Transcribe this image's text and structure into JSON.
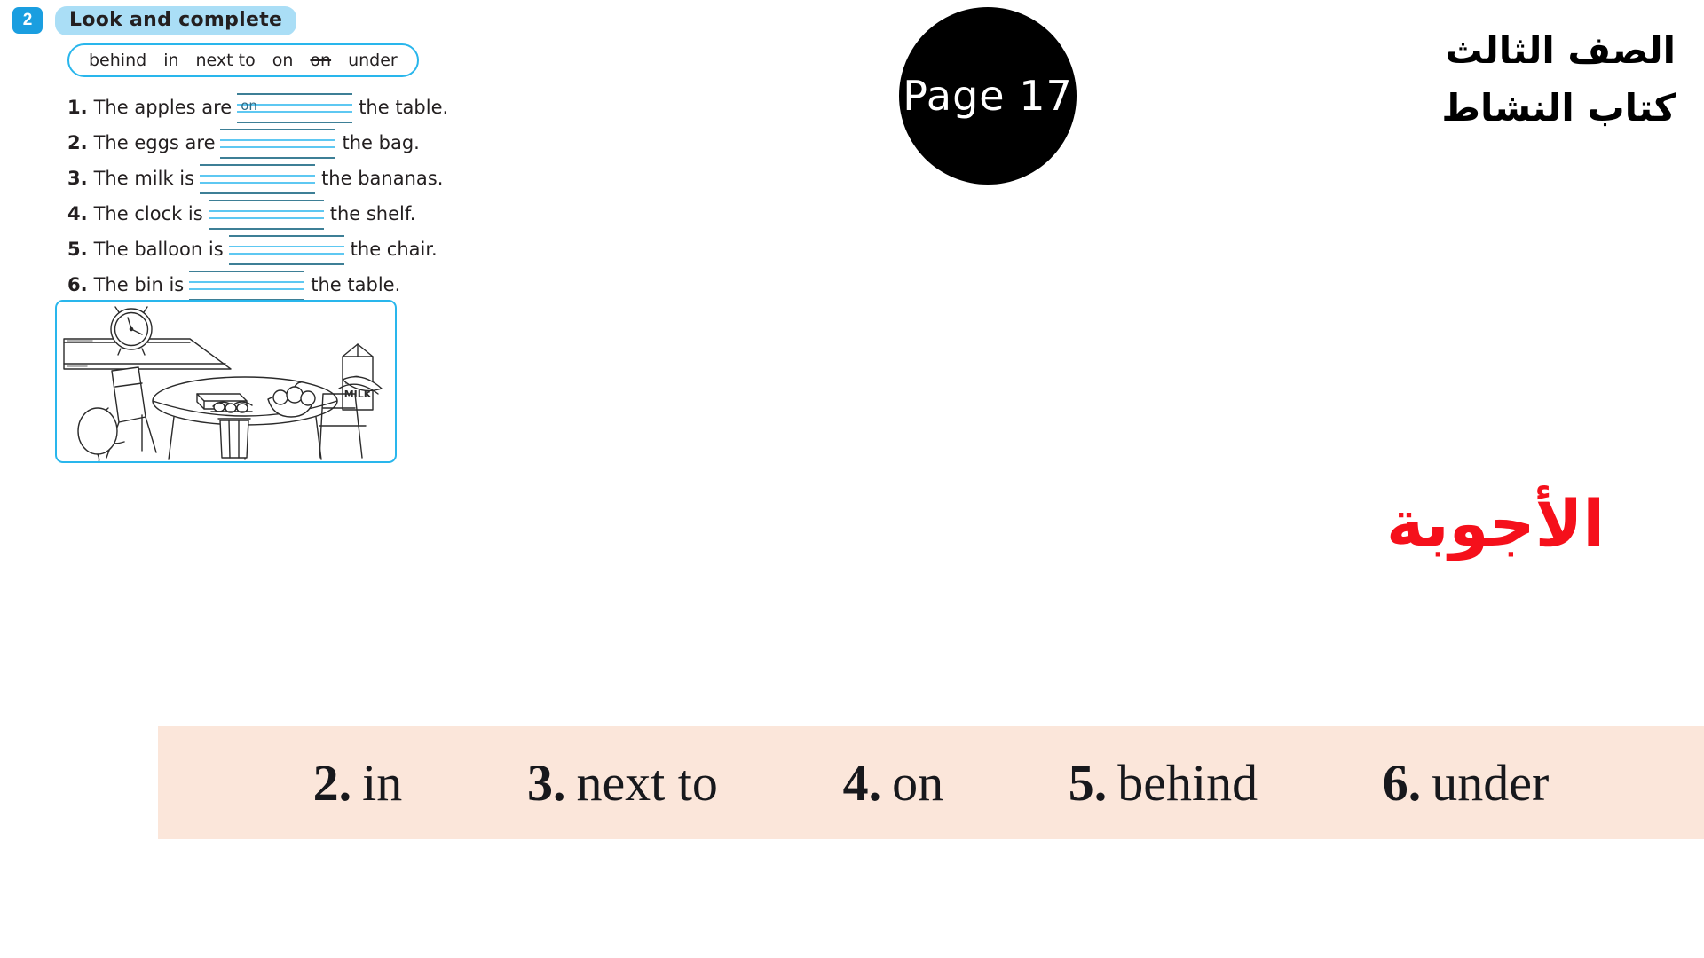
{
  "exercise": {
    "number": "2",
    "title": "Look and complete",
    "word_bank": [
      {
        "word": "behind",
        "used": false
      },
      {
        "word": "in",
        "used": false
      },
      {
        "word": "next to",
        "used": false
      },
      {
        "word": "on",
        "used": false
      },
      {
        "word": "on",
        "used": true
      },
      {
        "word": "under",
        "used": false
      }
    ],
    "items": [
      {
        "index": "1.",
        "before": "The apples are",
        "filled": "on",
        "after": "the table.",
        "blank_width": 130
      },
      {
        "index": "2.",
        "before": "The eggs are",
        "filled": "",
        "after": "the bag.",
        "blank_width": 130
      },
      {
        "index": "3.",
        "before": "The milk is",
        "filled": "",
        "after": "the bananas.",
        "blank_width": 130
      },
      {
        "index": "4.",
        "before": "The clock is",
        "filled": "",
        "after": "the shelf.",
        "blank_width": 130
      },
      {
        "index": "5.",
        "before": "The balloon is",
        "filled": "",
        "after": "the chair.",
        "blank_width": 130
      },
      {
        "index": "6.",
        "before": "The bin is",
        "filled": "",
        "after": "the table.",
        "blank_width": 130
      }
    ],
    "illustration_alt": "Kitchen scene: clock on a shelf, table with milk carton, bananas, eggs, bowl of apples, chairs, balloon and a bin under the table"
  },
  "page_badge": {
    "label": "Page 17"
  },
  "arabic": {
    "grade": "الصف الثالث",
    "book": "كتاب النشاط",
    "answers_heading": "الأجوبة"
  },
  "answers": [
    {
      "n": "2.",
      "w": "in"
    },
    {
      "n": "3.",
      "w": "next to"
    },
    {
      "n": "4.",
      "w": "on"
    },
    {
      "n": "5.",
      "w": "behind"
    },
    {
      "n": "6.",
      "w": "under"
    }
  ],
  "colors": {
    "accent_blue": "#29b6ec",
    "title_band": "#aadef6",
    "number_badge": "#1a9ee0",
    "rule_dark": "#3d7f96",
    "rule_light": "#5ec8f2",
    "answer_strip_bg": "#fbe6da",
    "answers_heading_red": "#f5101b",
    "badge_bg": "#000000"
  }
}
